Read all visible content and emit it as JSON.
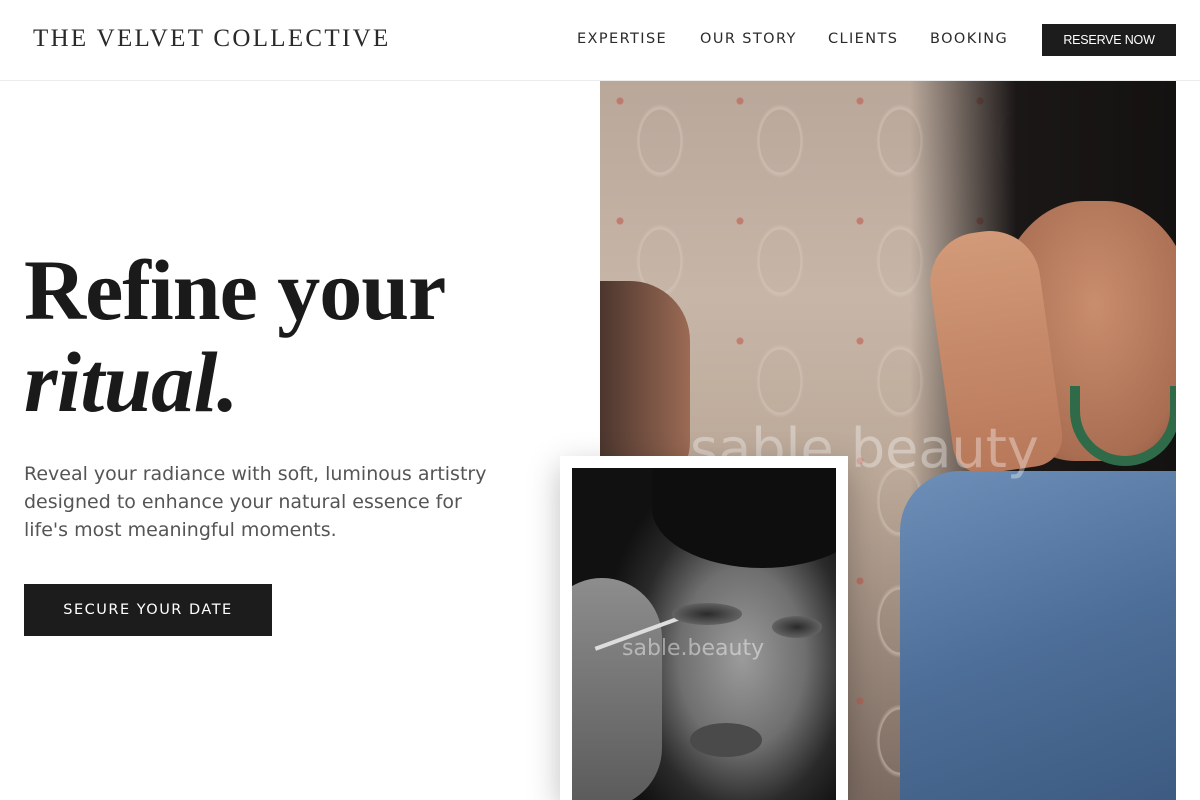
{
  "header": {
    "brand": "THE VELVET COLLECTIVE",
    "nav": [
      "EXPERTISE",
      "OUR STORY",
      "CLIENTS",
      "BOOKING"
    ],
    "reserve_label": "RESERVE NOW"
  },
  "hero": {
    "headline_line1": "Refine your",
    "headline_line2": "ritual.",
    "lede": "Reveal your radiance with soft, luminous artistry designed to enhance your natural essence for life's most meaningful moments.",
    "cta_label": "SECURE YOUR DATE"
  },
  "media": {
    "main_watermark": "sable.beauty",
    "secondary_watermark": "sable.beauty"
  },
  "colors": {
    "primary_dark": "#1c1c1c",
    "text_muted": "#555555",
    "background": "#ffffff"
  }
}
